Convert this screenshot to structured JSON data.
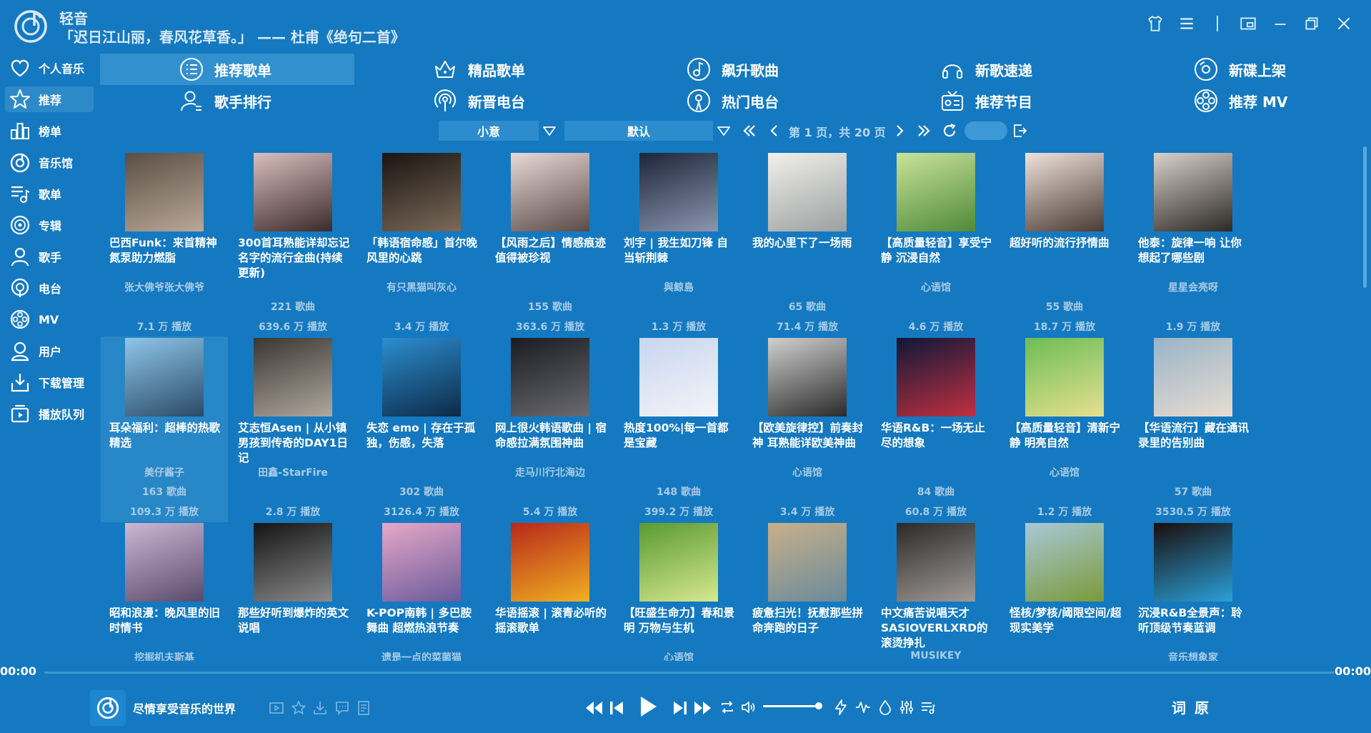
{
  "app": {
    "name": "轻音",
    "poem": "「迟日江山丽，春风花草香。」 —— 杜甫《绝句二首》"
  },
  "sidebar": {
    "items": [
      {
        "label": "个人音乐",
        "icon": "heart-icon"
      },
      {
        "label": "推荐",
        "icon": "star-icon",
        "active": true
      },
      {
        "label": "榜单",
        "icon": "bar-chart-icon"
      },
      {
        "label": "音乐馆",
        "icon": "music-disc-icon"
      },
      {
        "label": "歌单",
        "icon": "playlist-icon"
      },
      {
        "label": "专辑",
        "icon": "album-icon"
      },
      {
        "label": "歌手",
        "icon": "singer-icon"
      },
      {
        "label": "电台",
        "icon": "radio-icon"
      },
      {
        "label": "MV",
        "icon": "film-reel-icon"
      },
      {
        "label": "用户",
        "icon": "user-icon"
      },
      {
        "label": "下载管理",
        "icon": "download-icon"
      },
      {
        "label": "播放队列",
        "icon": "play-queue-icon"
      }
    ]
  },
  "categories": [
    {
      "label": "推荐歌单",
      "icon": "list-icon",
      "active": true
    },
    {
      "label": "精品歌单",
      "icon": "crown-icon"
    },
    {
      "label": "飙升歌曲",
      "icon": "rising-note-icon"
    },
    {
      "label": "新歌速递",
      "icon": "headphones-icon"
    },
    {
      "label": "新碟上架",
      "icon": "disc-icon"
    },
    {
      "label": "歌手排行",
      "icon": "singer-rank-icon"
    },
    {
      "label": "新晋电台",
      "icon": "broadcast-icon"
    },
    {
      "label": "热门电台",
      "icon": "podcast-icon"
    },
    {
      "label": "推荐节目",
      "icon": "program-icon"
    },
    {
      "label": "推荐 MV",
      "icon": "mv-reel-icon"
    }
  ],
  "filter": {
    "category": "小意",
    "sort": "默认",
    "page_info": "第 1 页，共 20 页",
    "jump_value": ""
  },
  "playlists": [
    {
      "title": "巴西Funk：来首精神氮泵助力燃脂",
      "author": "张大佛爷张大佛爷",
      "count": "",
      "plays": "7.1 万 播放",
      "color": "#5a4e44",
      "color2": "#b8a897"
    },
    {
      "title": "300首耳熟能详却忘记名字的流行金曲(持续更新)",
      "author": "",
      "count": "221 歌曲",
      "plays": "639.6 万 播放",
      "color": "#d9bfbd",
      "color2": "#3b2a2a"
    },
    {
      "title": "「韩语宿命感」首尔晚风里的心跳",
      "author": "有只黑猫叫灰心",
      "count": "",
      "plays": "3.4 万 播放",
      "color": "#1a1410",
      "color2": "#7a6a5a"
    },
    {
      "title": "【风雨之后】情感痕迹值得被珍视",
      "author": "",
      "count": "155 歌曲",
      "plays": "363.6 万 播放",
      "color": "#e8d8d6",
      "color2": "#5a4a48"
    },
    {
      "title": "刘宇 | 我生如刀锋 自当斩荆棘",
      "author": "與鲸島",
      "count": "",
      "plays": "1.3 万 播放",
      "color": "#1d2538",
      "color2": "#8a96b0"
    },
    {
      "title": "我的心里下了一场雨",
      "author": "",
      "count": "65 歌曲",
      "plays": "71.4 万 播放",
      "color": "#f2f0ec",
      "color2": "#9aa0a0"
    },
    {
      "title": "【高质量轻音】享受宁静 沉浸自然",
      "author": "心语馆",
      "count": "",
      "plays": "4.6 万 播放",
      "color": "#c9e39a",
      "color2": "#4f8a3a"
    },
    {
      "title": "超好听的流行抒情曲",
      "author": "",
      "count": "55 歌曲",
      "plays": "18.7 万 播放",
      "color": "#efe3dc",
      "color2": "#4a3a32"
    },
    {
      "title": "他泰：旋律一响 让你想起了哪些剧",
      "author": "星星会亮呀",
      "count": "",
      "plays": "1.9 万 播放",
      "color": "#d8d2cc",
      "color2": "#2c2824"
    },
    {
      "title": "耳朵福利：超棒的热歌精选",
      "author": "美仔酱子",
      "count": "163 歌曲",
      "plays": "109.3 万 播放",
      "color": "#8ec6ea",
      "color2": "#2a4a66"
    },
    {
      "title": "艾志恒Asen | 从小镇男孩到传奇的DAY1日记",
      "author": "田鑫-StarFire",
      "count": "",
      "plays": "2.8 万 播放",
      "color": "#3a3632",
      "color2": "#b0a89e"
    },
    {
      "title": "失恋 emo | 存在于孤独，伤感，失落",
      "author": "",
      "count": "302 歌曲",
      "plays": "3126.4 万 播放",
      "color": "#2c8ecf",
      "color2": "#0c2a48"
    },
    {
      "title": "网上很火韩语歌曲 | 宿命感拉满氛围神曲",
      "author": "走马川行北海边",
      "count": "",
      "plays": "5.4 万 播放",
      "color": "#1a1c22",
      "color2": "#6a6a70"
    },
    {
      "title": "热度100%|每一首都是宝藏",
      "author": "",
      "count": "148 歌曲",
      "plays": "399.2 万 播放",
      "color": "#c8d6f0",
      "color2": "#f4f4f8"
    },
    {
      "title": "【欧美旋律控】前奏封神 耳熟能详欧美神曲",
      "author": "心语馆",
      "count": "",
      "plays": "3.4 万 播放",
      "color": "#d0d0d0",
      "color2": "#2a2a2a"
    },
    {
      "title": "华语R&B：一场无止尽的想象",
      "author": "",
      "count": "84 歌曲",
      "plays": "60.8 万 播放",
      "color": "#0e1838",
      "color2": "#c03040"
    },
    {
      "title": "【高质量轻音】清新宁静 明亮自然",
      "author": "心语馆",
      "count": "",
      "plays": "1.2 万 播放",
      "color": "#6cbd56",
      "color2": "#e6e090"
    },
    {
      "title": "【华语流行】藏在通讯录里的告别曲",
      "author": "",
      "count": "57 歌曲",
      "plays": "3530.5 万 播放",
      "color": "#9ab4c6",
      "color2": "#e6dcd2"
    },
    {
      "title": "昭和浪漫：晚风里的旧时情书",
      "author": "挖掘机夫斯基",
      "count": "",
      "plays": "",
      "color": "#cbb7d6",
      "color2": "#5a4a6a"
    },
    {
      "title": "那些好听到爆炸的英文说唱",
      "author": "",
      "count": "",
      "plays": "",
      "color": "#141414",
      "color2": "#8a8a8a"
    },
    {
      "title": "K-POP南韩 | 多巴胺舞曲 超燃热浪节奏",
      "author": "遗是一点的菜菌猫",
      "count": "",
      "plays": "",
      "color": "#e6a8c8",
      "color2": "#6a5a9a"
    },
    {
      "title": "华语摇滚 | 滚青必听的摇滚歌单",
      "author": "",
      "count": "",
      "plays": "",
      "color": "#b8281c",
      "color2": "#f0b020"
    },
    {
      "title": "【旺盛生命力】春和景明 万物与生机",
      "author": "心语馆",
      "count": "",
      "plays": "",
      "color": "#5a9a32",
      "color2": "#d6e890"
    },
    {
      "title": "疲惫扫光！抚慰那些拼命奔跑的日子",
      "author": "",
      "count": "",
      "plays": "",
      "color": "#c8b08a",
      "color2": "#6a8a9a"
    },
    {
      "title": "中文痛苦说唱天才SASIOVERLXRD的滚烫挣扎",
      "author": "MUSIKEY",
      "count": "",
      "plays": "",
      "color": "#2a2a2a",
      "color2": "#a09a96"
    },
    {
      "title": "怪核/梦核/阈限空间/超现实美学",
      "author": "",
      "count": "",
      "plays": "",
      "color": "#a8c8d8",
      "color2": "#7a9a3a"
    },
    {
      "title": "沉浸R&B全景声：聆听顶级节奏蓝调",
      "author": "音乐想象家",
      "count": "",
      "plays": "",
      "color": "#1a0e0c",
      "color2": "#2aa0d8"
    }
  ],
  "player": {
    "time_current": "00:00",
    "time_total": "00:00",
    "now_playing": "尽情享受音乐的世界",
    "lyric_label": "词",
    "original_label": "原",
    "volume": 0.95
  }
}
